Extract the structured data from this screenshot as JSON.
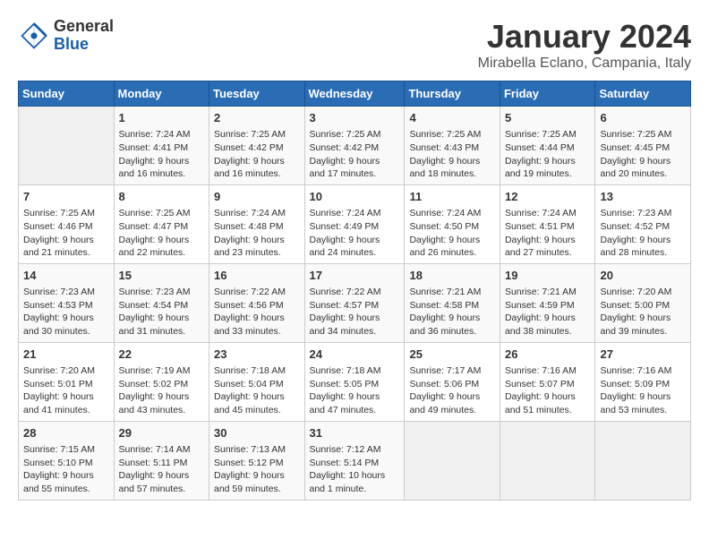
{
  "logo": {
    "general": "General",
    "blue": "Blue"
  },
  "title": "January 2024",
  "location": "Mirabella Eclano, Campania, Italy",
  "headers": [
    "Sunday",
    "Monday",
    "Tuesday",
    "Wednesday",
    "Thursday",
    "Friday",
    "Saturday"
  ],
  "rows": [
    [
      {
        "day": "",
        "info": ""
      },
      {
        "day": "1",
        "info": "Sunrise: 7:24 AM\nSunset: 4:41 PM\nDaylight: 9 hours\nand 16 minutes."
      },
      {
        "day": "2",
        "info": "Sunrise: 7:25 AM\nSunset: 4:42 PM\nDaylight: 9 hours\nand 16 minutes."
      },
      {
        "day": "3",
        "info": "Sunrise: 7:25 AM\nSunset: 4:42 PM\nDaylight: 9 hours\nand 17 minutes."
      },
      {
        "day": "4",
        "info": "Sunrise: 7:25 AM\nSunset: 4:43 PM\nDaylight: 9 hours\nand 18 minutes."
      },
      {
        "day": "5",
        "info": "Sunrise: 7:25 AM\nSunset: 4:44 PM\nDaylight: 9 hours\nand 19 minutes."
      },
      {
        "day": "6",
        "info": "Sunrise: 7:25 AM\nSunset: 4:45 PM\nDaylight: 9 hours\nand 20 minutes."
      }
    ],
    [
      {
        "day": "7",
        "info": "Sunrise: 7:25 AM\nSunset: 4:46 PM\nDaylight: 9 hours\nand 21 minutes."
      },
      {
        "day": "8",
        "info": "Sunrise: 7:25 AM\nSunset: 4:47 PM\nDaylight: 9 hours\nand 22 minutes."
      },
      {
        "day": "9",
        "info": "Sunrise: 7:24 AM\nSunset: 4:48 PM\nDaylight: 9 hours\nand 23 minutes."
      },
      {
        "day": "10",
        "info": "Sunrise: 7:24 AM\nSunset: 4:49 PM\nDaylight: 9 hours\nand 24 minutes."
      },
      {
        "day": "11",
        "info": "Sunrise: 7:24 AM\nSunset: 4:50 PM\nDaylight: 9 hours\nand 26 minutes."
      },
      {
        "day": "12",
        "info": "Sunrise: 7:24 AM\nSunset: 4:51 PM\nDaylight: 9 hours\nand 27 minutes."
      },
      {
        "day": "13",
        "info": "Sunrise: 7:23 AM\nSunset: 4:52 PM\nDaylight: 9 hours\nand 28 minutes."
      }
    ],
    [
      {
        "day": "14",
        "info": "Sunrise: 7:23 AM\nSunset: 4:53 PM\nDaylight: 9 hours\nand 30 minutes."
      },
      {
        "day": "15",
        "info": "Sunrise: 7:23 AM\nSunset: 4:54 PM\nDaylight: 9 hours\nand 31 minutes."
      },
      {
        "day": "16",
        "info": "Sunrise: 7:22 AM\nSunset: 4:56 PM\nDaylight: 9 hours\nand 33 minutes."
      },
      {
        "day": "17",
        "info": "Sunrise: 7:22 AM\nSunset: 4:57 PM\nDaylight: 9 hours\nand 34 minutes."
      },
      {
        "day": "18",
        "info": "Sunrise: 7:21 AM\nSunset: 4:58 PM\nDaylight: 9 hours\nand 36 minutes."
      },
      {
        "day": "19",
        "info": "Sunrise: 7:21 AM\nSunset: 4:59 PM\nDaylight: 9 hours\nand 38 minutes."
      },
      {
        "day": "20",
        "info": "Sunrise: 7:20 AM\nSunset: 5:00 PM\nDaylight: 9 hours\nand 39 minutes."
      }
    ],
    [
      {
        "day": "21",
        "info": "Sunrise: 7:20 AM\nSunset: 5:01 PM\nDaylight: 9 hours\nand 41 minutes."
      },
      {
        "day": "22",
        "info": "Sunrise: 7:19 AM\nSunset: 5:02 PM\nDaylight: 9 hours\nand 43 minutes."
      },
      {
        "day": "23",
        "info": "Sunrise: 7:18 AM\nSunset: 5:04 PM\nDaylight: 9 hours\nand 45 minutes."
      },
      {
        "day": "24",
        "info": "Sunrise: 7:18 AM\nSunset: 5:05 PM\nDaylight: 9 hours\nand 47 minutes."
      },
      {
        "day": "25",
        "info": "Sunrise: 7:17 AM\nSunset: 5:06 PM\nDaylight: 9 hours\nand 49 minutes."
      },
      {
        "day": "26",
        "info": "Sunrise: 7:16 AM\nSunset: 5:07 PM\nDaylight: 9 hours\nand 51 minutes."
      },
      {
        "day": "27",
        "info": "Sunrise: 7:16 AM\nSunset: 5:09 PM\nDaylight: 9 hours\nand 53 minutes."
      }
    ],
    [
      {
        "day": "28",
        "info": "Sunrise: 7:15 AM\nSunset: 5:10 PM\nDaylight: 9 hours\nand 55 minutes."
      },
      {
        "day": "29",
        "info": "Sunrise: 7:14 AM\nSunset: 5:11 PM\nDaylight: 9 hours\nand 57 minutes."
      },
      {
        "day": "30",
        "info": "Sunrise: 7:13 AM\nSunset: 5:12 PM\nDaylight: 9 hours\nand 59 minutes."
      },
      {
        "day": "31",
        "info": "Sunrise: 7:12 AM\nSunset: 5:14 PM\nDaylight: 10 hours\nand 1 minute."
      },
      {
        "day": "",
        "info": ""
      },
      {
        "day": "",
        "info": ""
      },
      {
        "day": "",
        "info": ""
      }
    ]
  ]
}
